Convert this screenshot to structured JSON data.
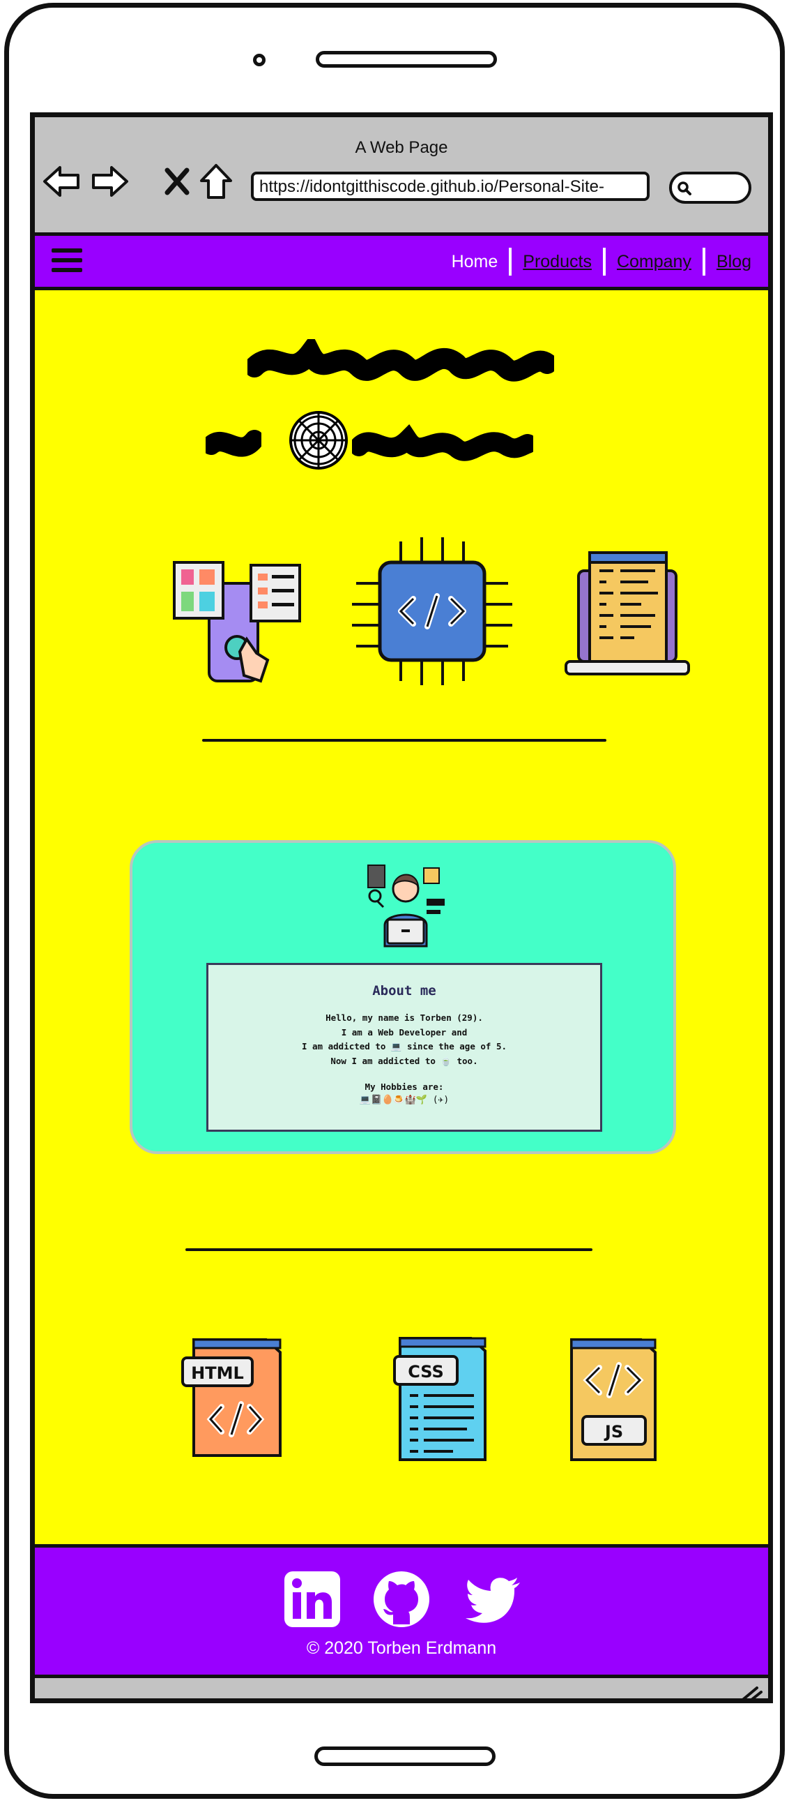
{
  "window": {
    "title": "A Web Page",
    "url": "https://idontgitthiscode.github.io/Personal-Site-"
  },
  "nav": {
    "items": [
      {
        "label": "Home",
        "active": true
      },
      {
        "label": "Products",
        "active": false
      },
      {
        "label": "Company",
        "active": false
      },
      {
        "label": "Blog",
        "active": false
      }
    ]
  },
  "hero": {
    "icons": [
      "web-page-design-icon",
      "web-spider-icon",
      "cpu-chip-code-icon",
      "laptop-code-icon"
    ]
  },
  "about": {
    "title": "About me",
    "lines": [
      "Hello, my name is Torben (29).",
      "I am a Web Developer and",
      "I am addicted to 💻 since the age of 5.",
      "Now I am addicted to 🍵 too."
    ],
    "hobbies_label": "My Hobbies are:",
    "hobbies": "💻📓🥚🍮🏰🌱 (✈)"
  },
  "tech": {
    "icons": [
      "html-file-icon",
      "css-file-icon",
      "js-file-icon"
    ],
    "labels": [
      "HTML",
      "CSS",
      "JS"
    ]
  },
  "footer": {
    "social": [
      "linkedin-icon",
      "github-icon",
      "twitter-icon"
    ],
    "copyright": "© 2020 Torben Erdmann"
  },
  "colors": {
    "nav": "#9900ff",
    "content": "#ffff00",
    "card": "#44ffc8",
    "chrome": "#c3c3c3"
  }
}
